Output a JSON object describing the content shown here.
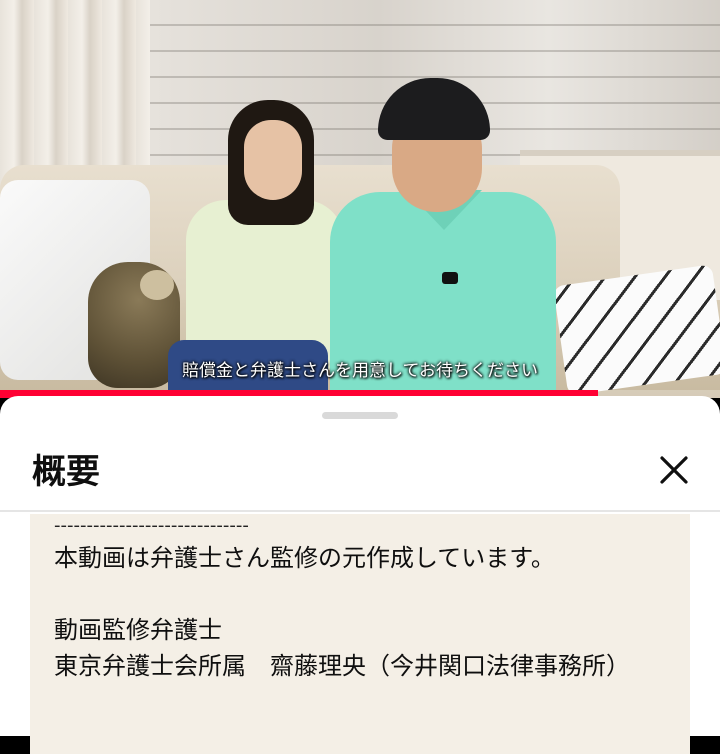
{
  "video": {
    "caption": "賠償金と弁護士さんを用意してお待ちください",
    "progress": 0.83,
    "accent_color": "#ff0033"
  },
  "sheet": {
    "title": "概要",
    "close_icon": "close-icon",
    "description": {
      "separator": "------------------------------",
      "line1": "本動画は弁護士さん監修の元作成しています。",
      "line2": "動画監修弁護士",
      "line3": "東京弁護士会所属　齋藤理央（今井関口法律事務所）"
    }
  }
}
